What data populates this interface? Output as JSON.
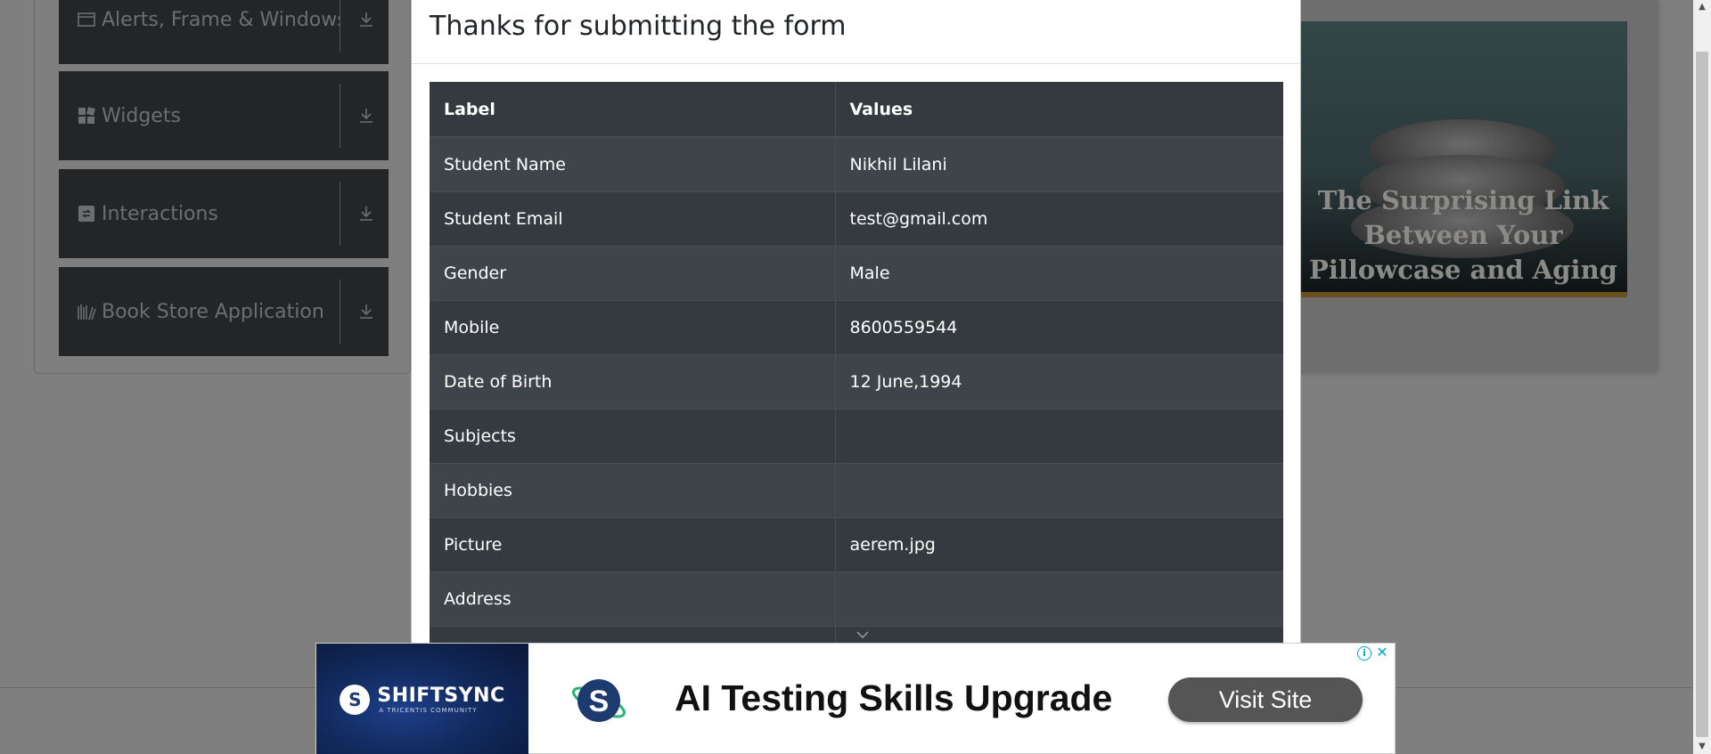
{
  "sidebar": {
    "groups": [
      {
        "label": "Alerts, Frame & Windows",
        "icon": "window-icon"
      },
      {
        "label": "Widgets",
        "icon": "widgets-icon"
      },
      {
        "label": "Interactions",
        "icon": "interactions-icon"
      },
      {
        "label": "Book Store Application",
        "icon": "books-icon"
      }
    ]
  },
  "side_ad": {
    "text": "The Surprising Link Between Your Pillowcase and Aging"
  },
  "modal": {
    "title": "Thanks for submitting the form",
    "table": {
      "headers": [
        "Label",
        "Values"
      ],
      "rows": [
        {
          "label": "Student Name",
          "value": "Nikhil Lilani"
        },
        {
          "label": "Student Email",
          "value": "test@gmail.com"
        },
        {
          "label": "Gender",
          "value": "Male"
        },
        {
          "label": "Mobile",
          "value": "8600559544"
        },
        {
          "label": "Date of Birth",
          "value": "12 June,1994"
        },
        {
          "label": "Subjects",
          "value": ""
        },
        {
          "label": "Hobbies",
          "value": ""
        },
        {
          "label": "Picture",
          "value": "aerem.jpg"
        },
        {
          "label": "Address",
          "value": ""
        }
      ]
    }
  },
  "bottom_ad": {
    "brand": "SHIFTSYNC",
    "brand_sub": "A TRICENTIS COMMUNITY",
    "headline": "AI Testing Skills Upgrade",
    "button": "Visit Site"
  },
  "colors": {
    "table_dark": "#343a40",
    "table_stripe": "#3e444a",
    "group_bg": "#242526",
    "overlay": "#7f7f7f",
    "ad_button": "#555555"
  }
}
